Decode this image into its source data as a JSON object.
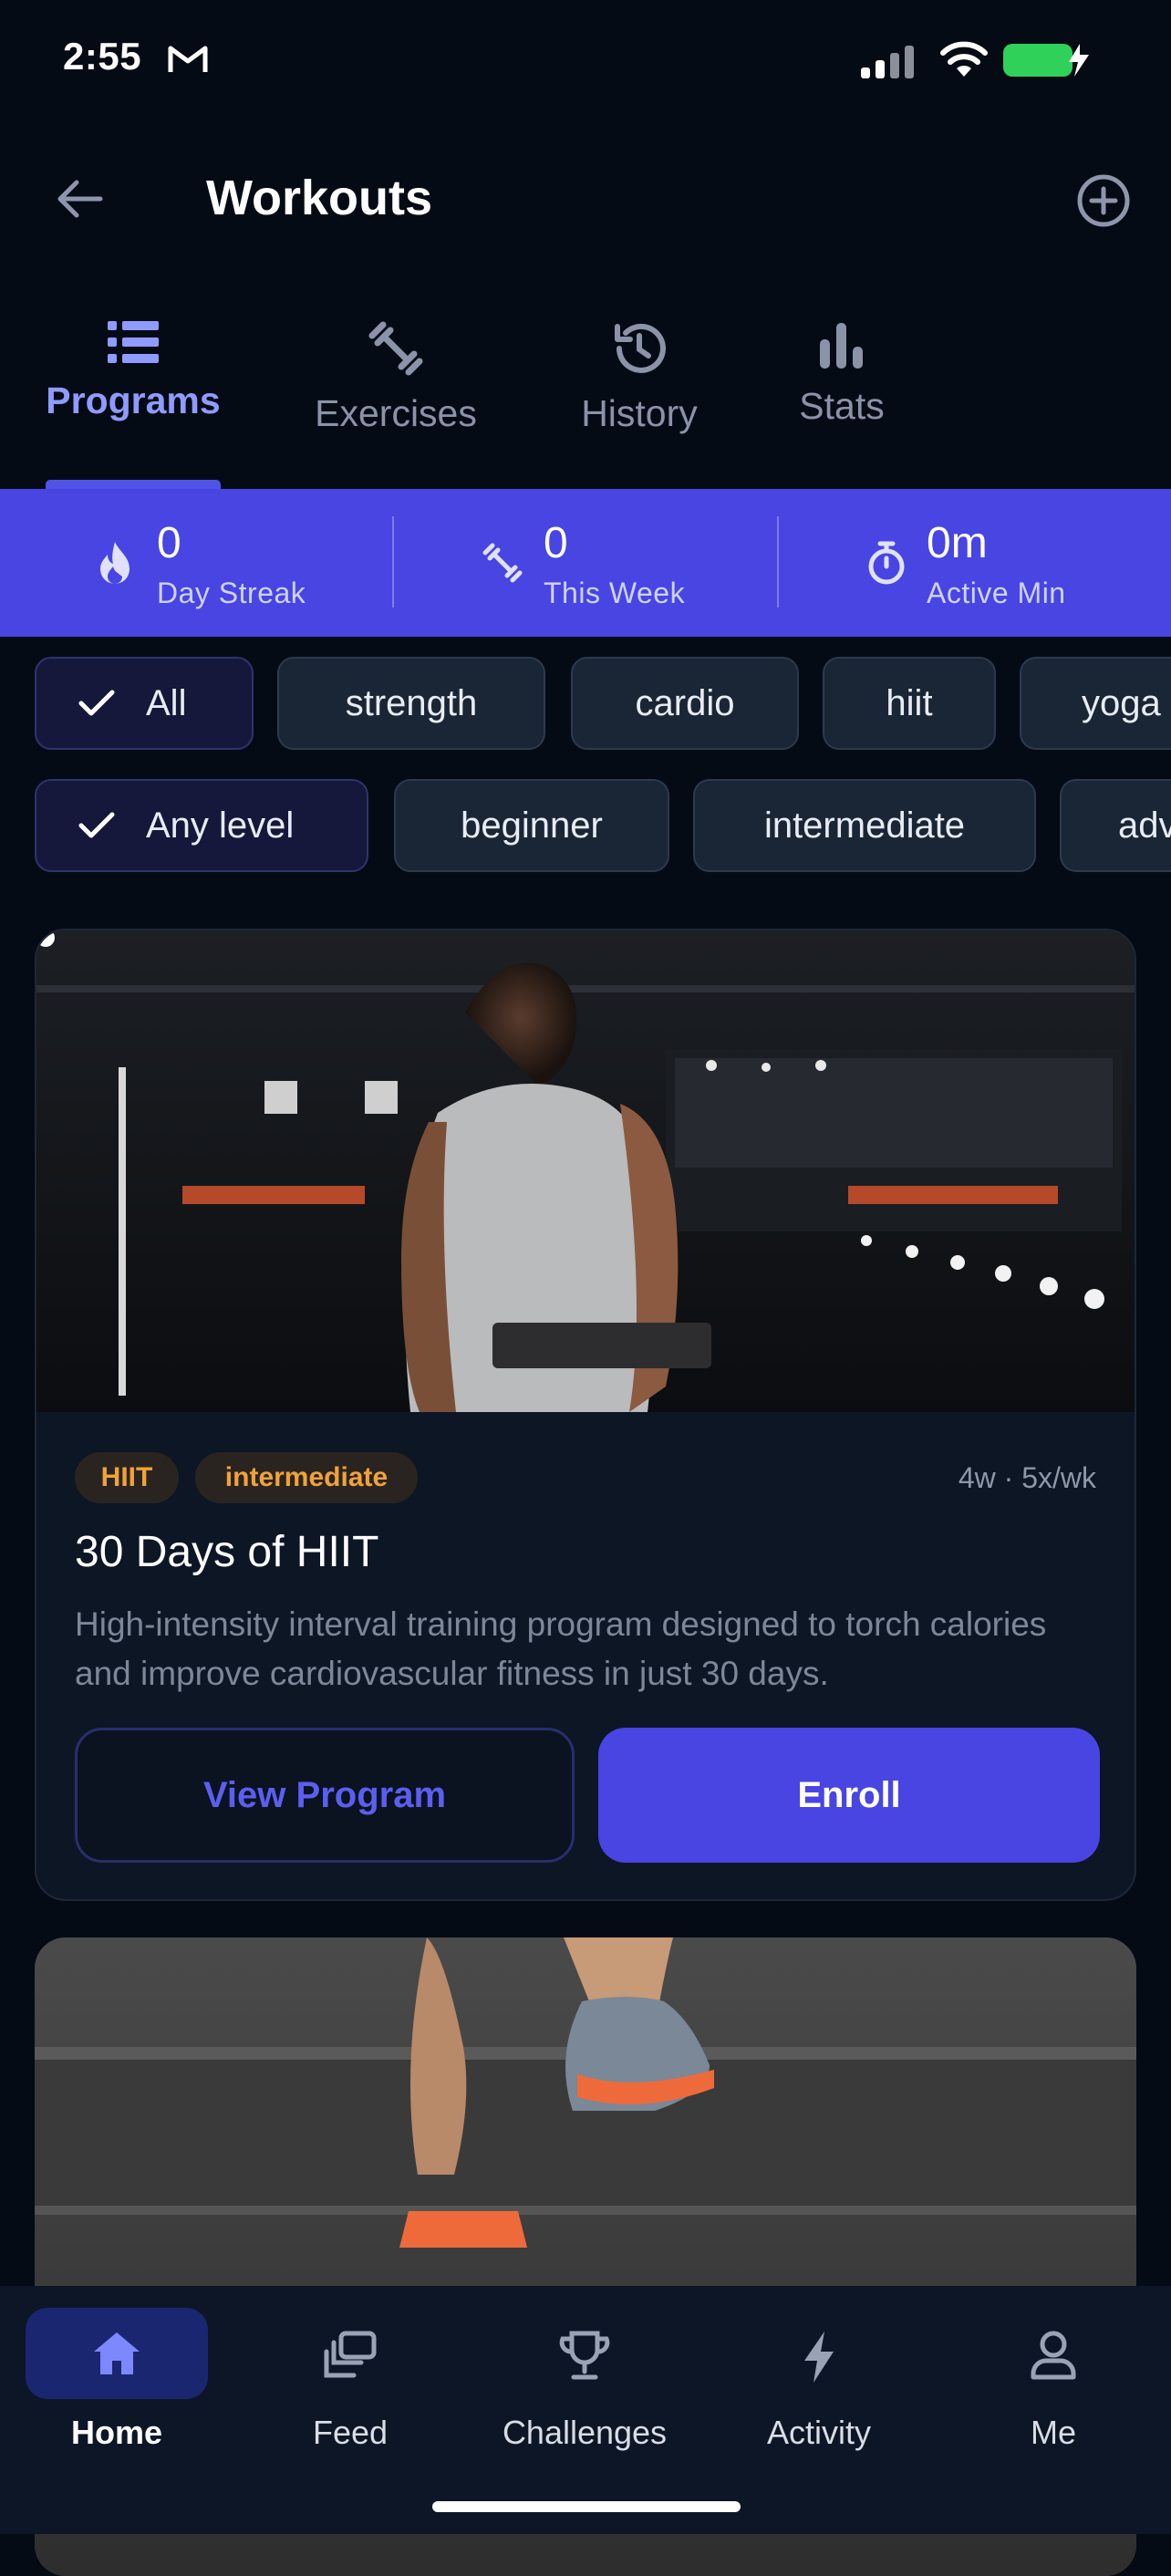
{
  "status_bar": {
    "time": "2:55"
  },
  "header": {
    "title": "Workouts"
  },
  "tabs": [
    {
      "label": "Programs",
      "icon": "list-icon",
      "active": true
    },
    {
      "label": "Exercises",
      "icon": "dumbbell-icon"
    },
    {
      "label": "History",
      "icon": "history-icon"
    },
    {
      "label": "Stats",
      "icon": "bar-chart-icon"
    }
  ],
  "stats": [
    {
      "value": "0",
      "label": "Day Streak",
      "icon": "flame-icon"
    },
    {
      "value": "0",
      "label": "This Week",
      "icon": "dumbbell-icon"
    },
    {
      "value": "0m",
      "label": "Active Min",
      "icon": "timer-icon"
    }
  ],
  "category_filters": [
    "All",
    "strength",
    "cardio",
    "hiit",
    "yoga"
  ],
  "level_filters": [
    "Any level",
    "beginner",
    "intermediate",
    "adv"
  ],
  "program_card": {
    "badges": [
      "HIIT",
      "intermediate"
    ],
    "frequency": "4w · 5x/wk",
    "title": "30 Days of HIIT",
    "description": "High-intensity interval training program designed to torch calories and improve cardiovascular fitness in just 30 days.",
    "view_label": "View Program",
    "enroll_label": "Enroll"
  },
  "bottom_nav": [
    {
      "label": "Home",
      "icon": "home-icon",
      "active": true
    },
    {
      "label": "Feed",
      "icon": "feed-icon"
    },
    {
      "label": "Challenges",
      "icon": "trophy-icon"
    },
    {
      "label": "Activity",
      "icon": "lightning-icon"
    },
    {
      "label": "Me",
      "icon": "user-icon"
    }
  ],
  "colors": {
    "accent": "#4845e3",
    "background": "#050b14",
    "badge_text": "#f0a23a"
  }
}
